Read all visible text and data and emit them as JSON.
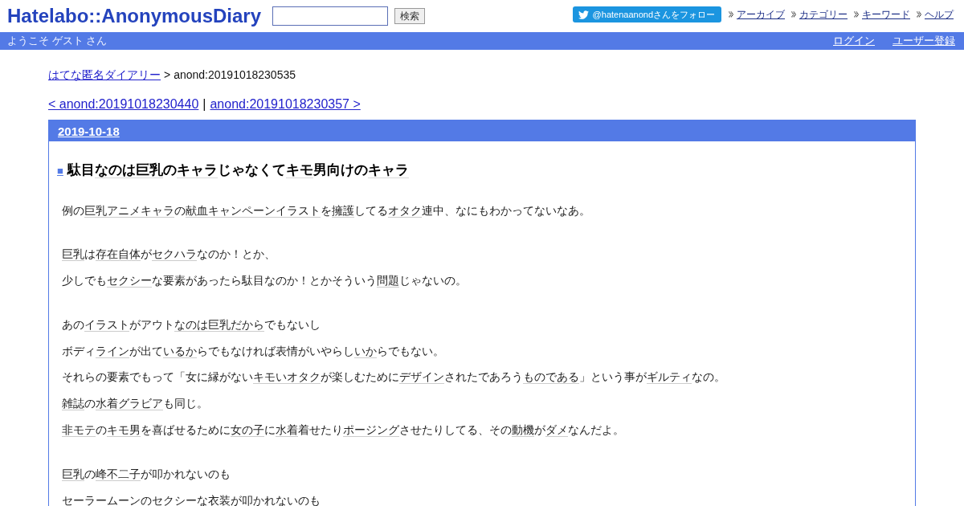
{
  "header": {
    "logo": "Hatelabo::AnonymousDiary",
    "search_button": "検索",
    "twitter_follow": "@hatenaanondさんをフォロー",
    "nav_links": [
      "アーカイブ",
      "カテゴリー",
      "キーワード",
      "ヘルプ"
    ]
  },
  "user_bar": {
    "greeting": "ようこそ ゲスト さん",
    "links": [
      "ログイン",
      "ユーザー登録"
    ]
  },
  "breadcrumb": {
    "link": "はてな匿名ダイアリー",
    "separator": ">",
    "current": "anond:20191018230535"
  },
  "pager": {
    "previous": "< anond:20191018230440",
    "separator": "|",
    "next": "anond:20191018230357 >"
  },
  "day": {
    "date": "2019-10-18",
    "entry": {
      "anchor": "■",
      "title": [
        {
          "kind": "text",
          "text": "駄目"
        },
        {
          "kind": "keyword",
          "text": "なのは"
        },
        {
          "kind": "keyword",
          "text": "巨乳"
        },
        {
          "kind": "text",
          "text": "の"
        },
        {
          "kind": "keyword",
          "text": "キャラ"
        },
        {
          "kind": "text",
          "text": "じゃなくて"
        },
        {
          "kind": "keyword",
          "text": "キモ"
        },
        {
          "kind": "text",
          "text": "男向けの"
        },
        {
          "kind": "keyword",
          "text": "キャラ"
        }
      ],
      "paragraphs": [
        {
          "lines": [
            [
              {
                "kind": "text",
                "text": "例の"
              },
              {
                "kind": "keyword",
                "text": "巨乳アニメキャラ"
              },
              {
                "kind": "text",
                "text": "の"
              },
              {
                "kind": "keyword",
                "text": "献血キャンペーンイラスト"
              },
              {
                "kind": "text",
                "text": "を"
              },
              {
                "kind": "keyword",
                "text": "擁護"
              },
              {
                "kind": "text",
                "text": "してる"
              },
              {
                "kind": "keyword",
                "text": "オタク"
              },
              {
                "kind": "text",
                "text": "連中、なにもわかってないなあ。"
              }
            ]
          ]
        },
        {
          "lines": [
            [
              {
                "kind": "keyword",
                "text": "巨乳"
              },
              {
                "kind": "text",
                "text": "は"
              },
              {
                "kind": "keyword",
                "text": "存在自体"
              },
              {
                "kind": "text",
                "text": "が"
              },
              {
                "kind": "keyword",
                "text": "セクハラ"
              },
              {
                "kind": "text",
                "text": "なのか！とか、"
              }
            ],
            [
              {
                "kind": "text",
                "text": "少しでも"
              },
              {
                "kind": "keyword",
                "text": "セクシー"
              },
              {
                "kind": "text",
                "text": "な要素があったら駄目なのか！とかそういう"
              },
              {
                "kind": "keyword",
                "text": "問題"
              },
              {
                "kind": "text",
                "text": "じゃないの。"
              }
            ]
          ]
        },
        {
          "lines": [
            [
              {
                "kind": "text",
                "text": "あの"
              },
              {
                "kind": "keyword",
                "text": "イラスト"
              },
              {
                "kind": "text",
                "text": "がアウト"
              },
              {
                "kind": "keyword",
                "text": "なのは"
              },
              {
                "kind": "keyword",
                "text": "巨乳"
              },
              {
                "kind": "keyword",
                "text": "だから"
              },
              {
                "kind": "text",
                "text": "でもないし"
              }
            ],
            [
              {
                "kind": "text",
                "text": "ボディ"
              },
              {
                "kind": "keyword",
                "text": "ライン"
              },
              {
                "kind": "text",
                "text": "が出て"
              },
              {
                "kind": "keyword",
                "text": "いるか"
              },
              {
                "kind": "text",
                "text": "らでもなければ表情がいやらし"
              },
              {
                "kind": "keyword",
                "text": "いか"
              },
              {
                "kind": "text",
                "text": "らでもない。"
              }
            ],
            [
              {
                "kind": "text",
                "text": "それらの要素でもって「女に縁がない"
              },
              {
                "kind": "keyword",
                "text": "キモいオタク"
              },
              {
                "kind": "text",
                "text": "が楽しむために"
              },
              {
                "kind": "keyword",
                "text": "デザイン"
              },
              {
                "kind": "text",
                "text": "されたであろう"
              },
              {
                "kind": "keyword",
                "text": "ものである"
              },
              {
                "kind": "text",
                "text": "」という事が"
              },
              {
                "kind": "keyword",
                "text": "ギルティ"
              },
              {
                "kind": "text",
                "text": "なの。"
              }
            ],
            [
              {
                "kind": "keyword",
                "text": "雑誌"
              },
              {
                "kind": "text",
                "text": "の"
              },
              {
                "kind": "keyword",
                "text": "水着グラビア"
              },
              {
                "kind": "text",
                "text": "も同じ。"
              }
            ],
            [
              {
                "kind": "keyword",
                "text": "非モテ"
              },
              {
                "kind": "text",
                "text": "の"
              },
              {
                "kind": "keyword",
                "text": "キモ男"
              },
              {
                "kind": "text",
                "text": "を喜ばせるために"
              },
              {
                "kind": "keyword",
                "text": "女の子"
              },
              {
                "kind": "text",
                "text": "に"
              },
              {
                "kind": "keyword",
                "text": "水着"
              },
              {
                "kind": "text",
                "text": "着せたり"
              },
              {
                "kind": "keyword",
                "text": "ポージング"
              },
              {
                "kind": "text",
                "text": "させたりしてる、その"
              },
              {
                "kind": "keyword",
                "text": "動機"
              },
              {
                "kind": "text",
                "text": "が"
              },
              {
                "kind": "keyword",
                "text": "ダメ"
              },
              {
                "kind": "text",
                "text": "なんだよ。"
              }
            ]
          ]
        },
        {
          "lines": [
            [
              {
                "kind": "keyword",
                "text": "巨乳"
              },
              {
                "kind": "text",
                "text": "の"
              },
              {
                "kind": "keyword",
                "text": "峰不二子"
              },
              {
                "kind": "text",
                "text": "が叩かれないのも"
              }
            ],
            [
              {
                "kind": "text",
                "text": "セーラームーンのセクシーな衣装が叩かれないのも"
              }
            ]
          ]
        }
      ]
    }
  }
}
